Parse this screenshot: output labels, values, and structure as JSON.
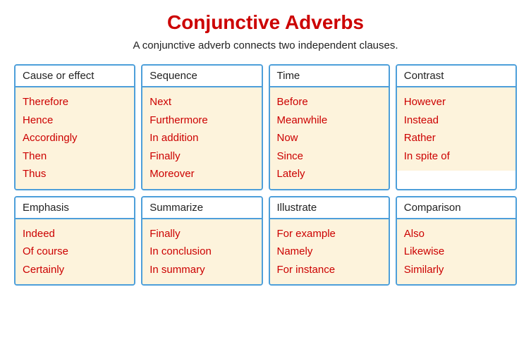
{
  "title": "Conjunctive Adverbs",
  "subtitle": "A conjunctive adverb connects two independent clauses.",
  "cards": [
    {
      "id": "cause-effect",
      "header": "Cause or effect",
      "items": [
        "Therefore",
        "Hence",
        "Accordingly",
        "Then",
        "Thus"
      ]
    },
    {
      "id": "sequence",
      "header": "Sequence",
      "items": [
        "Next",
        "Furthermore",
        "In addition",
        "Finally",
        "Moreover"
      ]
    },
    {
      "id": "time",
      "header": "Time",
      "items": [
        "Before",
        "Meanwhile",
        "Now",
        "Since",
        "Lately"
      ]
    },
    {
      "id": "contrast",
      "header": "Contrast",
      "items": [
        "However",
        "Instead",
        "Rather",
        "In spite of"
      ]
    },
    {
      "id": "emphasis",
      "header": "Emphasis",
      "items": [
        "Indeed",
        "Of course",
        "Certainly"
      ]
    },
    {
      "id": "summarize",
      "header": "Summarize",
      "items": [
        "Finally",
        "In conclusion",
        "In summary"
      ]
    },
    {
      "id": "illustrate",
      "header": "Illustrate",
      "items": [
        "For example",
        "Namely",
        "For instance"
      ]
    },
    {
      "id": "comparison",
      "header": "Comparison",
      "items": [
        "Also",
        "Likewise",
        "Similarly"
      ]
    }
  ]
}
